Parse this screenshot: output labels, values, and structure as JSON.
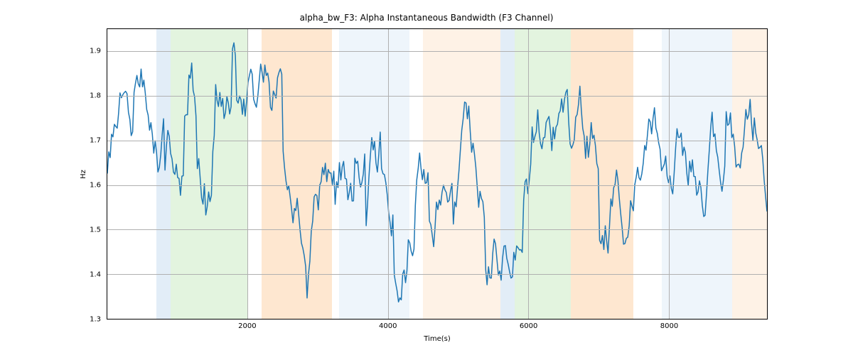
{
  "chart_data": {
    "type": "line",
    "title": "alpha_bw_F3: Alpha Instantaneous Bandwidth (F3 Channel)",
    "xlabel": "Time(s)",
    "ylabel": "Hz",
    "xlim": [
      0,
      9400
    ],
    "ylim": [
      1.3,
      1.95
    ],
    "xticks": [
      2000,
      4000,
      6000,
      8000
    ],
    "yticks": [
      1.3,
      1.4,
      1.5,
      1.6,
      1.7,
      1.8,
      1.9
    ],
    "bands": [
      {
        "x0": 700,
        "x1": 900,
        "color": "#c6dbef"
      },
      {
        "x0": 900,
        "x1": 2000,
        "color": "#c7e9c0"
      },
      {
        "x0": 2200,
        "x1": 3200,
        "color": "#fdd0a2"
      },
      {
        "x0": 3300,
        "x1": 4300,
        "color": "#deebf7"
      },
      {
        "x0": 4500,
        "x1": 5600,
        "color": "#fee6ce"
      },
      {
        "x0": 5600,
        "x1": 5800,
        "color": "#c6dbef"
      },
      {
        "x0": 5800,
        "x1": 6600,
        "color": "#c7e9c0"
      },
      {
        "x0": 6600,
        "x1": 7500,
        "color": "#fdd0a2"
      },
      {
        "x0": 7900,
        "x1": 8900,
        "color": "#deebf7"
      },
      {
        "x0": 8900,
        "x1": 9400,
        "color": "#fee6ce"
      }
    ],
    "line_color": "#1f77b4",
    "seed": 7
  }
}
